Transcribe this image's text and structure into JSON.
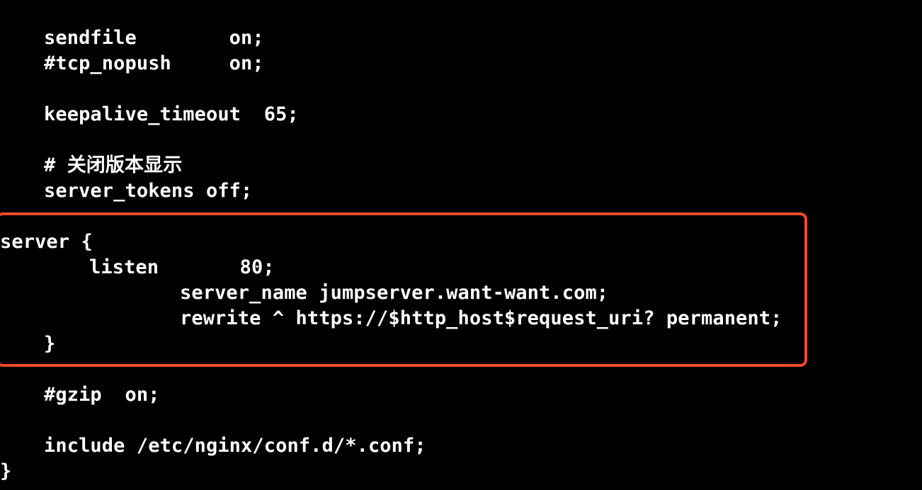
{
  "accent_color": "#ee4b2b",
  "background_color": "#000000",
  "text_color": "#ffffff",
  "lines": [
    "sendfile        on;",
    "#tcp_nopush     on;",
    "keepalive_timeout  65;",
    "# 关闭版本显示",
    "server_tokens off;",
    "server {",
    "listen       80;",
    "server_name jumpserver.want-want.com;",
    "rewrite ^ https://$http_host$request_uri? permanent;",
    "}",
    "#gzip  on;",
    "include /etc/nginx/conf.d/*.conf;",
    "}"
  ]
}
